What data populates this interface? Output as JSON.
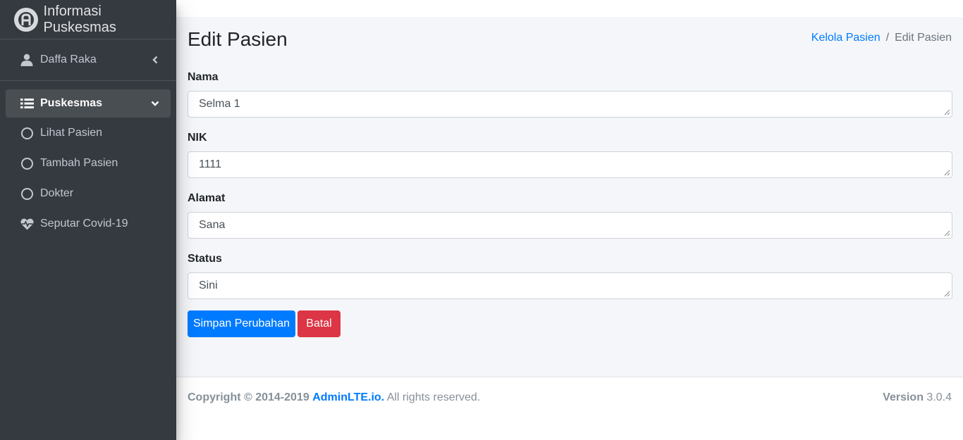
{
  "brand": {
    "title": "Informasi Puskesmas",
    "logo_icon": "adminlte-logo-icon"
  },
  "user": {
    "name": "Daffa Raka",
    "icon": "user-icon"
  },
  "sidebar": {
    "items": [
      {
        "label": "Puskesmas",
        "icon": "list-icon",
        "active": true
      },
      {
        "label": "Lihat Pasien",
        "icon": "circle-icon"
      },
      {
        "label": "Tambah Pasien",
        "icon": "circle-icon"
      },
      {
        "label": "Dokter",
        "icon": "circle-icon"
      },
      {
        "label": "Seputar Covid-19",
        "icon": "heartbeat-icon"
      }
    ]
  },
  "page": {
    "title": "Edit Pasien",
    "breadcrumb": {
      "parent": "Kelola Pasien",
      "separator": "/",
      "current": "Edit Pasien"
    }
  },
  "form": {
    "fields": [
      {
        "label": "Nama",
        "value": "Selma 1"
      },
      {
        "label": "NIK",
        "value": "1111"
      },
      {
        "label": "Alamat",
        "value": "Sana"
      },
      {
        "label": "Status",
        "value": "Sini"
      }
    ],
    "save_label": "Simpan Perubahan",
    "cancel_label": "Batal"
  },
  "footer": {
    "copyright_prefix": "Copyright © 2014-2019",
    "brand_link": "AdminLTE.io.",
    "rights": " All rights reserved.",
    "version_label": "Version",
    "version_value": " 3.0.4"
  },
  "colors": {
    "sidebar_bg": "#343a40",
    "primary": "#007bff",
    "danger": "#dc3545",
    "content_bg": "#f4f6f9"
  }
}
